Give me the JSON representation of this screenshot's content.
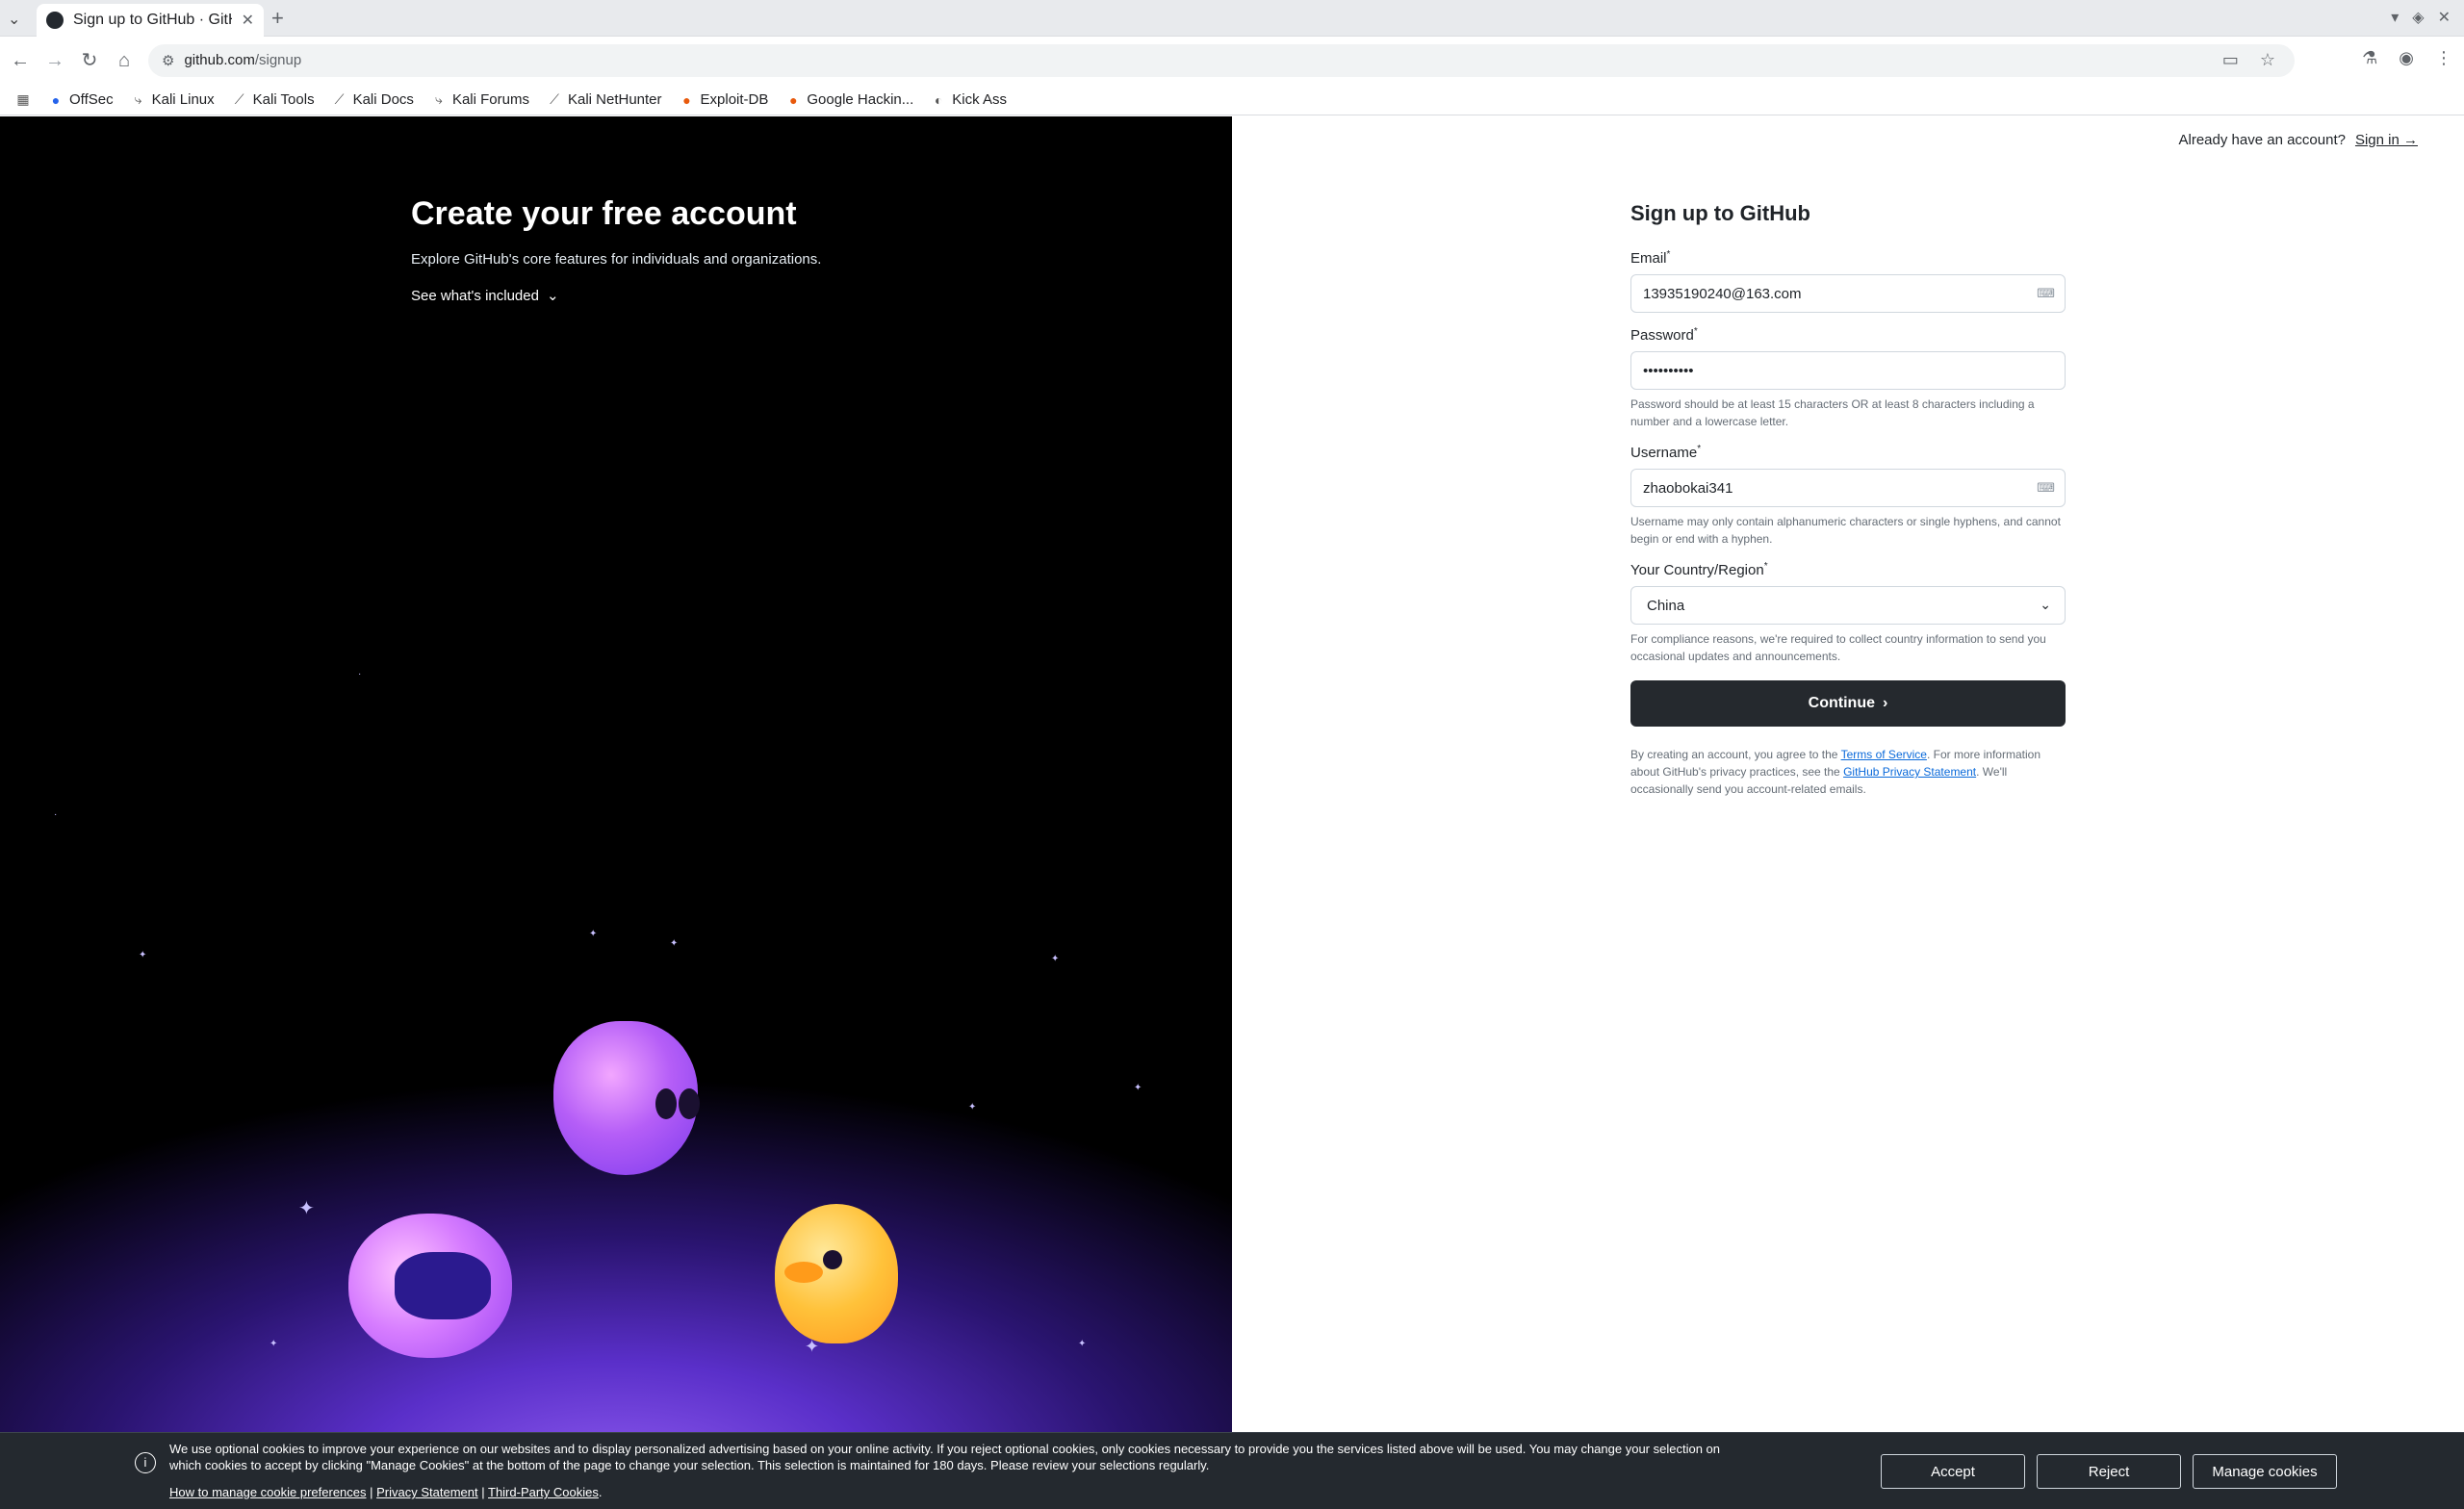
{
  "browser": {
    "tab_title": "Sign up to GitHub · GitHub",
    "url_host": "github.com",
    "url_path": "/signup",
    "bookmarks": [
      "OffSec",
      "Kali Linux",
      "Kali Tools",
      "Kali Docs",
      "Kali Forums",
      "Kali NetHunter",
      "Exploit-DB",
      "Google Hackin...",
      "Kick Ass"
    ]
  },
  "hero": {
    "headline": "Create your free account",
    "subline": "Explore GitHub's core features for individuals and organizations.",
    "see_included": "See what's included"
  },
  "top": {
    "already_text": "Already have an account?",
    "sign_in": "Sign in →"
  },
  "form": {
    "title": "Sign up to GitHub",
    "email_label": "Email",
    "email_value": "13935190240@163.com",
    "password_label": "Password",
    "password_value": "••••••••••",
    "password_hint": "Password should be at least 15 characters OR at least 8 characters including a number and a lowercase letter.",
    "username_label": "Username",
    "username_value": "zhaobokai341",
    "username_hint": "Username may only contain alphanumeric characters or single hyphens, and cannot begin or end with a hyphen.",
    "country_label": "Your Country/Region",
    "country_value": "China",
    "country_hint": "For compliance reasons, we're required to collect country information to send you occasional updates and announcements.",
    "continue_label": "Continue",
    "legal_prefix": "By creating an account, you agree to the ",
    "terms_link": "Terms of Service",
    "legal_middle": ". For more information about GitHub's privacy practices, see the ",
    "privacy_link": "GitHub Privacy Statement",
    "legal_suffix": ". We'll occasionally send you account-related emails."
  },
  "cookie": {
    "message": "We use optional cookies to improve your experience on our websites and to display personalized advertising based on your online activity. If you reject optional cookies, only cookies necessary to provide you the services listed above will be used. You may change your selection on which cookies to accept by clicking \"Manage Cookies\" at the bottom of the page to change your selection. This selection is maintained for 180 days. Please review your selections regularly.",
    "link_manage_prefs": "How to manage cookie preferences",
    "link_privacy": "Privacy Statement",
    "link_third_party": "Third-Party Cookies",
    "accept": "Accept",
    "reject": "Reject",
    "manage": "Manage cookies"
  }
}
